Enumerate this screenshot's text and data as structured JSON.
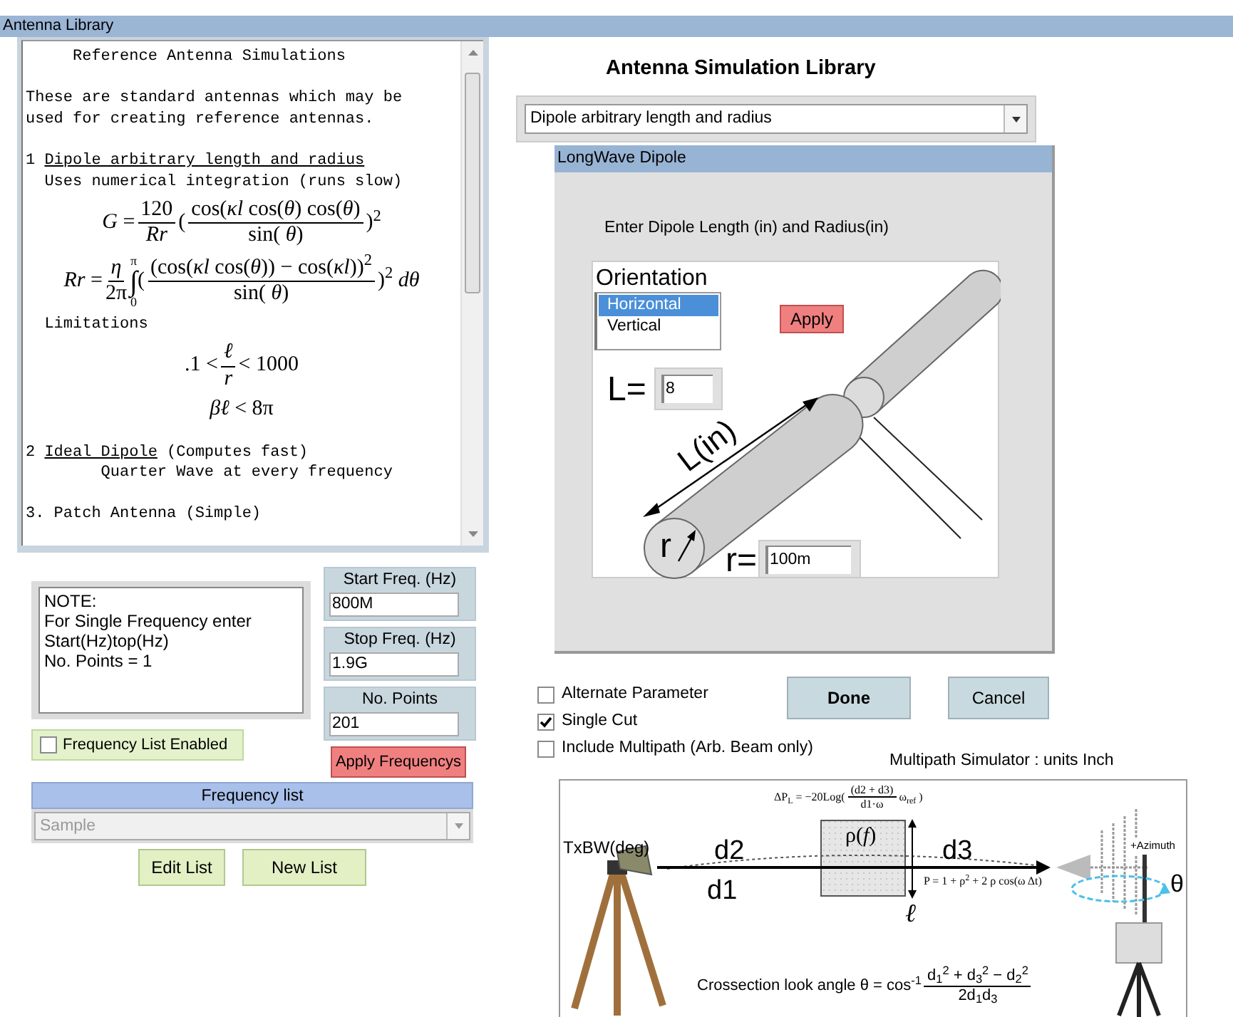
{
  "window": {
    "title": "Antenna Library"
  },
  "reference": {
    "blocks": [
      {
        "kind": "line",
        "text": "     Reference Antenna Simulations"
      },
      {
        "kind": "para",
        "text": "These are standard antennas which may be\nused for creating reference antennas."
      },
      {
        "kind": "item",
        "number": "1",
        "link": "Dipole arbitrary length and radius"
      },
      {
        "kind": "line",
        "text": "  Uses numerical integration (runs slow)"
      },
      {
        "kind": "equation",
        "parts": [
          {
            "kind": "text",
            "text": "*G* = "
          },
          {
            "kind": "frac",
            "num": "120",
            "den": "*Rr*"
          },
          {
            "kind": "text",
            "text": "("
          },
          {
            "kind": "frac",
            "num": "cos(*κl* cos(*θ*) cos(*θ*)",
            "den": "sin( *θ*)"
          },
          {
            "kind": "text",
            "text": ")$^{2}$"
          }
        ]
      },
      {
        "kind": "equation",
        "parts": [
          {
            "kind": "text",
            "text": "*Rr* = "
          },
          {
            "kind": "frac",
            "num": "*η*",
            "den": "2π"
          },
          {
            "kind": "integral",
            "upper": "π",
            "symbol": "∫",
            "lower": "0"
          },
          {
            "kind": "text",
            "text": "("
          },
          {
            "kind": "frac",
            "num": "(cos(*κl* cos(*θ*)) − cos(*κl*))$^{2}$",
            "den": "sin( *θ*)"
          },
          {
            "kind": "text",
            "text": ")$^{2}$ *dθ*"
          }
        ]
      },
      {
        "kind": "line",
        "text": "  Limitations"
      },
      {
        "kind": "equation",
        "parts": [
          {
            "kind": "text",
            "text": ".1 < "
          },
          {
            "kind": "frac",
            "num": "*ℓ*",
            "den": "*r*"
          },
          {
            "kind": "text",
            "text": " < 1000"
          }
        ]
      },
      {
        "kind": "equation",
        "parts": [
          {
            "kind": "text",
            "text": "*βℓ* < 8π"
          }
        ]
      },
      {
        "kind": "item",
        "number": "2",
        "link": "Ideal Dipole",
        "after": "(Computes fast)"
      },
      {
        "kind": "line",
        "text": "        Quarter Wave at every frequency"
      },
      {
        "kind": "para",
        "text": "3. Patch Antenna (Simple)"
      }
    ]
  },
  "note": {
    "text": "NOTE:\nFor Single Frequency enter\nStart(Hz)top(Hz)\nNo. Points = 1"
  },
  "frequency_fields": [
    {
      "label": "Start Freq. (Hz)",
      "value": "800M"
    },
    {
      "label": "Stop Freq. (Hz)",
      "value": "1.9G"
    },
    {
      "label": "No. Points",
      "value": "201"
    }
  ],
  "frequency_list_enabled": {
    "label": "Frequency List Enabled",
    "checked": false
  },
  "apply_frequencies": "Apply Frequencys",
  "frequency_list": {
    "title": "Frequency list",
    "value": "Sample",
    "disabled": true
  },
  "list_buttons": [
    "Edit List",
    "New List"
  ],
  "heading": "Antenna Simulation Library",
  "antenna_select": {
    "value": "Dipole arbitrary length and radius"
  },
  "dialog": {
    "title": "LongWave Dipole",
    "instruction": "Enter Dipole Length (in) and Radius(in)",
    "orientation": {
      "label": "Orientation",
      "options": [
        {
          "label": "Horizontal",
          "selected": true
        },
        {
          "label": "Vertical",
          "selected": false
        }
      ]
    },
    "apply": "Apply",
    "length": {
      "label": "L=",
      "value": "8"
    },
    "radius": {
      "label": "r=",
      "value": "100m"
    },
    "drawing_labels": {
      "length": "L(in)",
      "radius": "r"
    }
  },
  "options": [
    {
      "label": "Alternate Parameter",
      "checked": false
    },
    {
      "label": "Single Cut",
      "checked": true
    },
    {
      "label": "Include Multipath (Arb. Beam only)",
      "checked": false
    }
  ],
  "actions": [
    {
      "label": "Done",
      "default": true
    },
    {
      "label": "Cancel",
      "default": false
    }
  ],
  "multipath": {
    "title": "Multipath Simulator : units Inch",
    "labels": {
      "transmitter": "TxBW(deg)",
      "d2": "d2",
      "d1": "d1",
      "d3": "d3",
      "reflect": "ρ(*f*)",
      "height": "ℓ",
      "azimuth": "+Azimuth",
      "theta": "θ"
    },
    "loss_formula": [
      {
        "kind": "text",
        "text": "ΔP$_{L}$ = −20Log("
      },
      {
        "kind": "frac",
        "num": "(d2 + d3)",
        "den": "d1·ω"
      },
      {
        "kind": "text",
        "text": " ω$_{ref}$ )"
      }
    ],
    "power_formula": [
      {
        "kind": "text",
        "text": "P = 1 + ρ$^{2}$ + 2 ρ cos(ω Δt)"
      }
    ],
    "angle_formula": [
      {
        "kind": "text",
        "text": "Crossection look angle  θ = cos$^{-1}$ "
      },
      {
        "kind": "frac",
        "num": "d$_{1}$$^{2}$ + d$_{3}$$^{2}$ − d$_{2}$$^{2}$",
        "den": "2d$_{1}$d$_{3}$"
      }
    ]
  }
}
